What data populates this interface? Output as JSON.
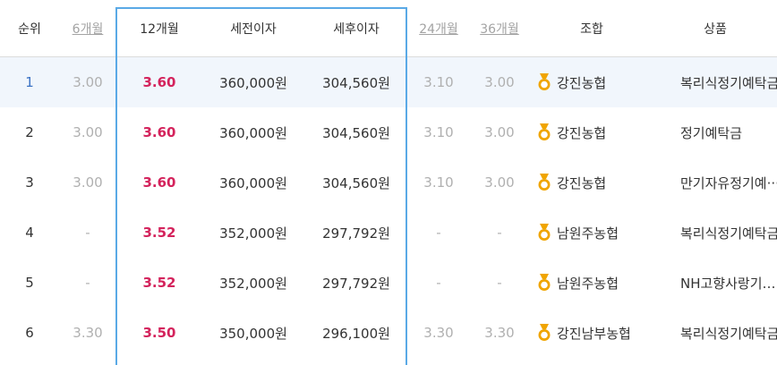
{
  "headers": {
    "rank": "순위",
    "m6": "6개월",
    "m12": "12개월",
    "pretax": "세전이자",
    "aftertax": "세후이자",
    "m24": "24개월",
    "m36": "36개월",
    "union": "조합",
    "product": "상품"
  },
  "colors": {
    "highlight": "#5aa9e6",
    "rate12": "#d4235c",
    "medal": "#f0a500",
    "rank_first": "#3c73c4"
  },
  "icons": {
    "medal": "medal-icon"
  },
  "rows": [
    {
      "rank": "1",
      "m6": "3.00",
      "m12": "3.60",
      "pretax": "360,000원",
      "aftertax": "304,560원",
      "m24": "3.10",
      "m36": "3.00",
      "union": "강진농협",
      "product": "복리식정기예탁금"
    },
    {
      "rank": "2",
      "m6": "3.00",
      "m12": "3.60",
      "pretax": "360,000원",
      "aftertax": "304,560원",
      "m24": "3.10",
      "m36": "3.00",
      "union": "강진농협",
      "product": "정기예탁금"
    },
    {
      "rank": "3",
      "m6": "3.00",
      "m12": "3.60",
      "pretax": "360,000원",
      "aftertax": "304,560원",
      "m24": "3.10",
      "m36": "3.00",
      "union": "강진농협",
      "product": "만기자유정기예···"
    },
    {
      "rank": "4",
      "m6": "-",
      "m12": "3.52",
      "pretax": "352,000원",
      "aftertax": "297,792원",
      "m24": "-",
      "m36": "-",
      "union": "남원주농협",
      "product": "복리식정기예탁금"
    },
    {
      "rank": "5",
      "m6": "-",
      "m12": "3.52",
      "pretax": "352,000원",
      "aftertax": "297,792원",
      "m24": "-",
      "m36": "-",
      "union": "남원주농협",
      "product": "NH고향사랑기부···"
    },
    {
      "rank": "6",
      "m6": "3.30",
      "m12": "3.50",
      "pretax": "350,000원",
      "aftertax": "296,100원",
      "m24": "3.30",
      "m36": "3.30",
      "union": "강진남부농협",
      "product": "복리식정기예탁금"
    }
  ]
}
